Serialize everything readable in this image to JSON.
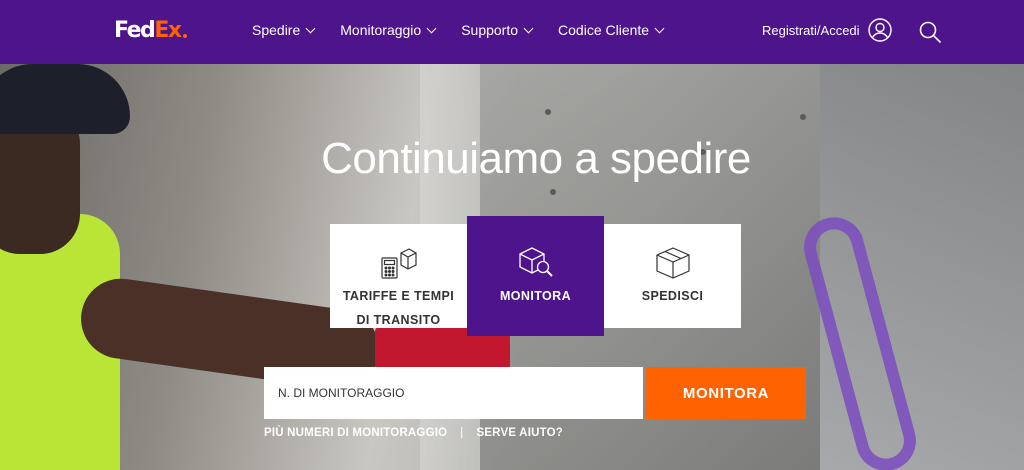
{
  "header": {
    "logo_left": "Fed",
    "logo_right": "Ex",
    "menu": [
      {
        "label": "Spedire"
      },
      {
        "label": "Monitoraggio"
      },
      {
        "label": "Supporto"
      },
      {
        "label": "Codice Cliente"
      }
    ],
    "login_label": "Registrati/Accedi",
    "user_icon": "user-circle-icon",
    "search_icon": "search-icon"
  },
  "hero": {
    "headline": "Continuiamo a spedire",
    "tabs": [
      {
        "line1": "TARIFFE E TEMPI",
        "line2": "DI TRANSITO",
        "icon": "calculator-box-icon",
        "active": false
      },
      {
        "line1": "MONITORA",
        "icon": "box-magnifier-icon",
        "active": true
      },
      {
        "line1": "SPEDISCI",
        "icon": "box-icon",
        "active": false
      }
    ],
    "tracking": {
      "placeholder": "N. DI MONITORAGGIO",
      "button_label": "MONITORA",
      "link_more": "PIÙ NUMERI DI MONITORAGGIO",
      "separator": "|",
      "link_help": "SERVE AIUTO?"
    }
  },
  "colors": {
    "brand_purple": "#4d148c",
    "brand_orange": "#ff6200"
  }
}
